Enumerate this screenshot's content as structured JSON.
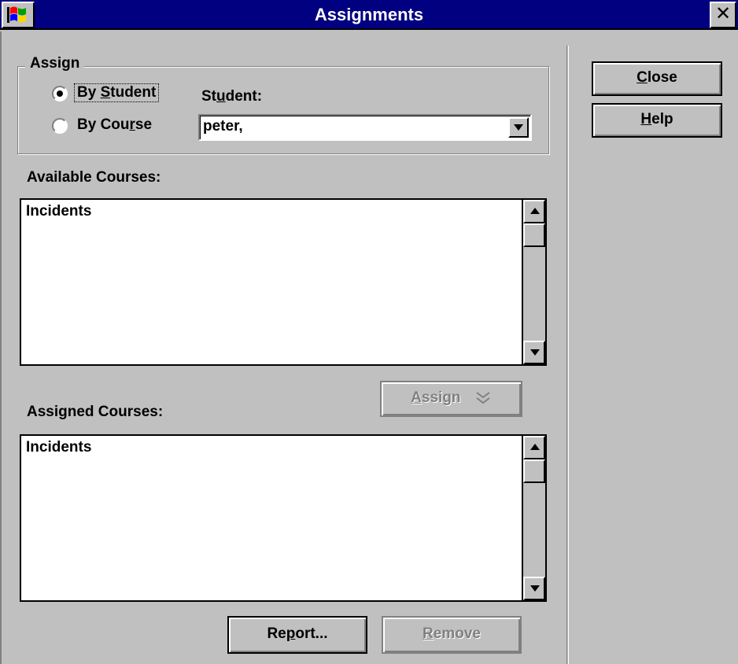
{
  "window": {
    "title": "Assignments",
    "close_glyph": "✕",
    "icons": {
      "system_menu": "windows-flag-icon",
      "close": "close-icon"
    }
  },
  "assign_group": {
    "label": "Assign",
    "by_student": {
      "pre": "By ",
      "accel": "S",
      "post": "tudent",
      "selected": true
    },
    "by_course": {
      "pre": "By Cou",
      "accel": "r",
      "post": "se",
      "selected": false
    },
    "student_label": {
      "pre": "St",
      "accel": "u",
      "post": "dent:"
    },
    "student_value": "peter,"
  },
  "available": {
    "label": "Available Courses:",
    "items": [
      "Incidents"
    ]
  },
  "assign_button": {
    "accel": "A",
    "post": "ssign",
    "enabled": false
  },
  "assigned": {
    "label": "Assigned Courses:",
    "items": [
      "Incidents"
    ]
  },
  "report_button": {
    "pre": "Re",
    "accel": "p",
    "post": "ort..."
  },
  "remove_button": {
    "accel": "R",
    "post": "emove",
    "enabled": false
  },
  "side_buttons": {
    "close": {
      "accel": "C",
      "post": "lose"
    },
    "help": {
      "accel": "H",
      "post": "elp"
    }
  },
  "colors": {
    "titlebar": "#000080",
    "face": "#c0c0c0",
    "disabled_text": "#808080"
  }
}
